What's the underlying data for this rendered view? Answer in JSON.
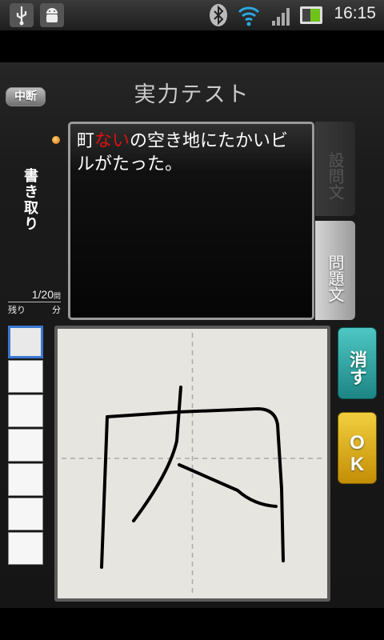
{
  "status_bar": {
    "time": "16:15",
    "icons": [
      "usb-icon",
      "android-debug-icon",
      "bluetooth-icon",
      "wifi-icon",
      "signal-icon",
      "battery-icon"
    ]
  },
  "header": {
    "title": "実力テスト",
    "pause_label": "中断"
  },
  "mode_label": "書き取り",
  "question": {
    "prefix": "町",
    "highlight": "ない",
    "suffix": "の空き地にたかいビルがたった。",
    "highlight_color": "#e01010"
  },
  "tabs": {
    "setsumon": "設問文",
    "mondai": "問題文"
  },
  "progress": {
    "count": "1/20",
    "count_unit": "問",
    "remaining_label": "残り",
    "minutes_label": "分"
  },
  "answer_slots": 7,
  "buttons": {
    "erase_label": "消す",
    "ok_label": "OK"
  },
  "colors": {
    "accent_teal": "#1c8584",
    "accent_yellow": "#f2cf3e",
    "active_slot": "#3a78d0"
  }
}
